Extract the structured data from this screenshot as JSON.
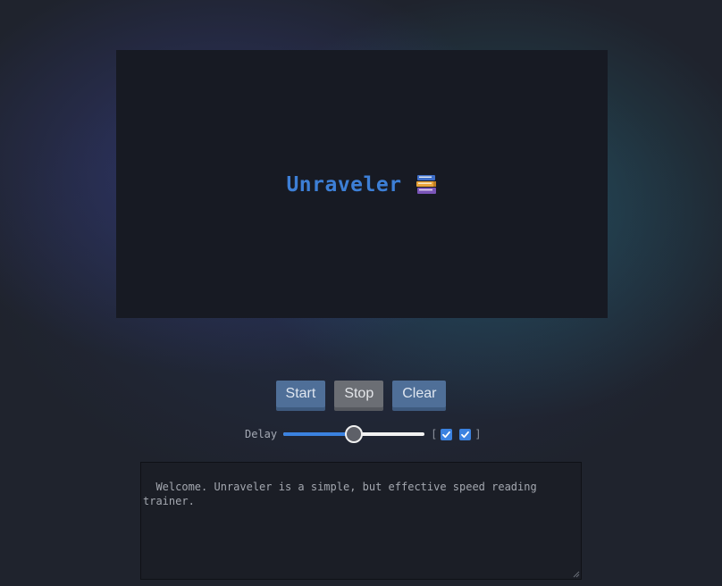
{
  "display": {
    "word": "Unraveler",
    "icon": "books-icon"
  },
  "buttons": {
    "start_label": "Start",
    "stop_label": "Stop",
    "clear_label": "Clear"
  },
  "delay": {
    "label": "Delay",
    "level_fraction": 0.5,
    "bracket_open": "[",
    "bracket_close": "]",
    "checkbox_1_checked": true,
    "checkbox_2_checked": true
  },
  "text_input": {
    "value": "Welcome. Unraveler is a simple, but effective speed reading trainer."
  },
  "colors": {
    "accent_blue": "#3d7fd6",
    "button_blue": "#4f6f98",
    "button_gray": "#6b6e74",
    "display_bg": "#171a23",
    "page_bg": "#1f232d"
  }
}
